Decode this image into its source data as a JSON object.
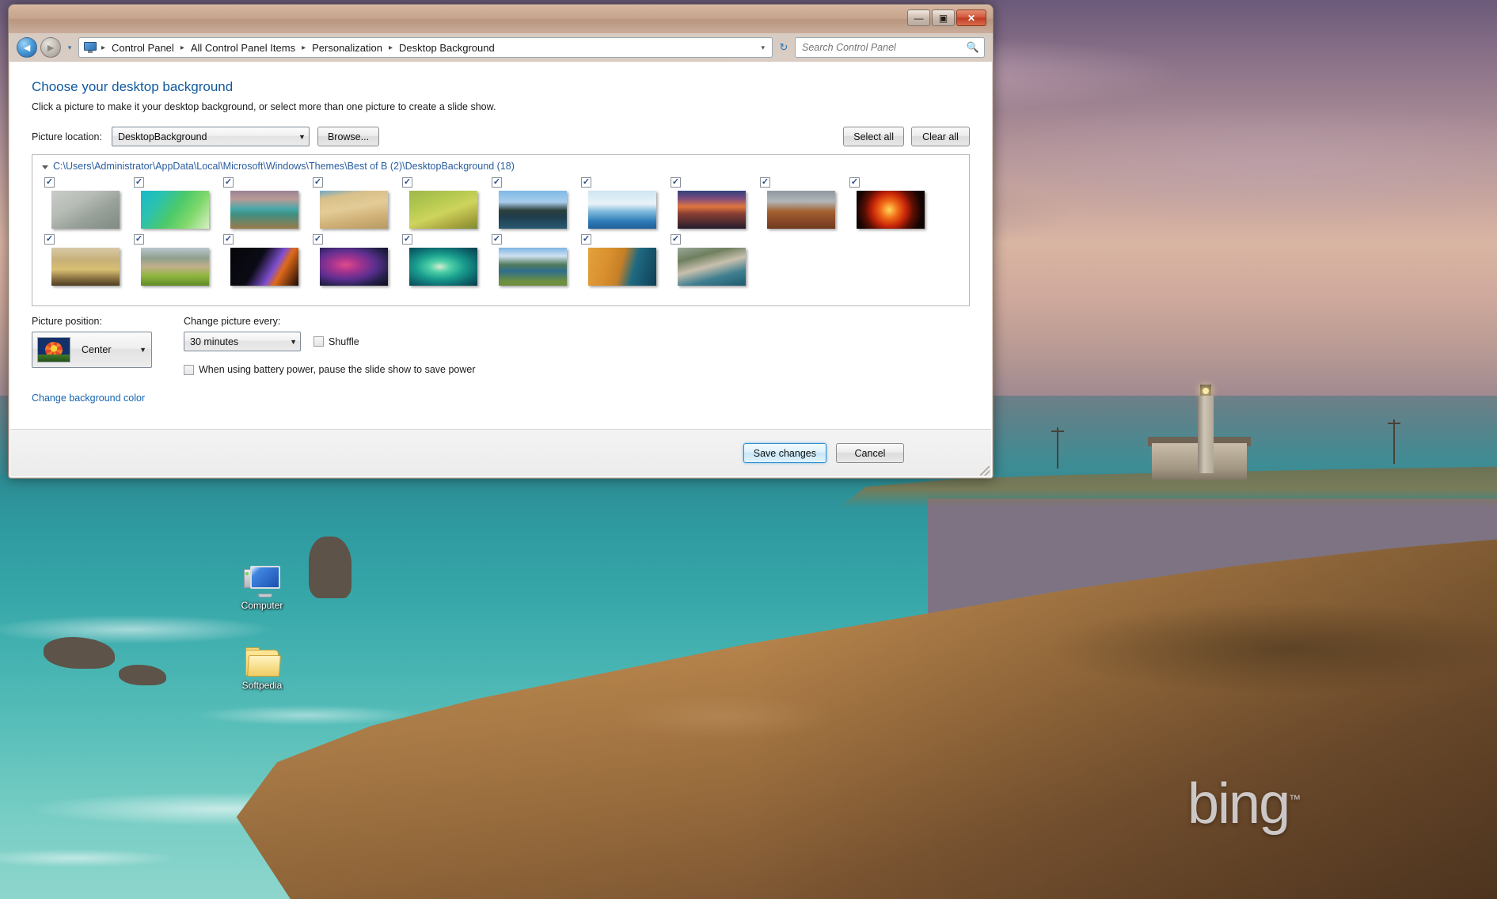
{
  "window": {
    "controls": {
      "minimize": "—",
      "maximize": "▣",
      "close": "✕"
    },
    "address": {
      "breadcrumbs": [
        "Control Panel",
        "All Control Panel Items",
        "Personalization",
        "Desktop Background"
      ],
      "separator": "▸",
      "dropdown_caret": "▾",
      "refresh": "↻"
    },
    "search": {
      "placeholder": "Search Control Panel",
      "value": "",
      "icon": "search-icon"
    },
    "nav": {
      "back": "◄",
      "forward": "►",
      "history_caret": "▾"
    }
  },
  "page": {
    "title": "Choose your desktop background",
    "subtitle": "Click a picture to make it your desktop background, or select more than one picture to create a slide show."
  },
  "picture_location": {
    "label": "Picture location:",
    "selected": "DesktopBackground",
    "browse_label": "Browse..."
  },
  "selection_buttons": {
    "select_all": "Select all",
    "clear_all": "Clear all"
  },
  "gallery": {
    "group_header": "C:\\Users\\Administrator\\AppData\\Local\\Microsoft\\Windows\\Themes\\Best of B (2)\\DesktopBackground (18)",
    "collapse_icon": "▲",
    "items": [
      {
        "name": "thumb-whale-tail",
        "checked": true,
        "css": "linear-gradient(150deg,#c9ccc8 0%,#b7bcb6 35%,#9aa39b 60%,#7f8a82 100%)"
      },
      {
        "name": "thumb-green-aerial",
        "checked": true,
        "css": "linear-gradient(125deg,#17b9c9 0%,#2ac2b0 25%,#4cc96a 50%,#7fd86b 72%,#d8efc4 100%)"
      },
      {
        "name": "thumb-coastal-cliff",
        "checked": true,
        "css": "linear-gradient(180deg,#9a8496 0%,#b99a96 22%,#46a8a8 48%,#3f8f80 62%,#9a7a4a 100%)"
      },
      {
        "name": "thumb-desert-dune",
        "checked": true,
        "css": "linear-gradient(170deg,#6da9c9 0%,#d9c08a 18%,#e3cb97 45%,#cdae74 75%,#b69a63 100%)"
      },
      {
        "name": "thumb-fox-in-grass",
        "checked": true,
        "css": "linear-gradient(160deg,#9fb84c 0%,#b3c84f 30%,#cdd45c 55%,#a9a63f 80%,#7e8a33 100%)"
      },
      {
        "name": "thumb-lake-reflection",
        "checked": true,
        "css": "linear-gradient(180deg,#7fb9e6 0%,#a8cdec 30%,#2b3f3a 52%,#1f3e4f 70%,#2a5a72 100%)"
      },
      {
        "name": "thumb-ice-floes",
        "checked": true,
        "css": "linear-gradient(180deg,#cfe6f2 0%,#e8f2f7 35%,#7fb9dc 55%,#2f7cb8 80%,#1e5f9a 100%)"
      },
      {
        "name": "thumb-city-sunset",
        "checked": true,
        "css": "linear-gradient(180deg,#31407a 0%,#7a4a7e 20%,#e0763f 42%,#8a3f33 60%,#241c2c 100%)"
      },
      {
        "name": "thumb-monument-valley",
        "checked": true,
        "css": "linear-gradient(180deg,#8f99a0 0%,#b0b6b8 28%,#a3602f 55%,#8a4a28 78%,#6e3a20 100%)"
      },
      {
        "name": "thumb-solar-flare",
        "checked": true,
        "css": "radial-gradient(circle at 48% 50%, #ffd75a 0%, #f06a16 22%, #c52408 42%, #5c0f04 60%, #120402 82%)"
      },
      {
        "name": "thumb-golden-palace",
        "checked": true,
        "css": "linear-gradient(180deg,#d8c9a8 0%,#c7b079 32%,#d8bf72 58%,#8c7342 80%,#4e3e22 100%)"
      },
      {
        "name": "thumb-lions-savanna",
        "checked": true,
        "css": "linear-gradient(180deg,#b9c7cf 0%,#8fa08c 28%,#c3b08a 50%,#8eb63f 74%,#5f8a26 100%)"
      },
      {
        "name": "thumb-lava-lightning",
        "checked": true,
        "css": "linear-gradient(120deg,#050509 0%,#0b0b16 40%,#7f4fd0 62%,#e06a1a 72%,#1a0a06 100%)"
      },
      {
        "name": "thumb-nebula",
        "checked": true,
        "css": "radial-gradient(ellipse at 38% 45%, #e04a8c 0%, #a0338f 25%, #5c2f8f 50%, #24204a 75%, #0d0b1c 100%)"
      },
      {
        "name": "thumb-atoll-island",
        "checked": true,
        "css": "radial-gradient(ellipse at 45% 50%, #d8e9d0 0%, #4fd0a8 20%, #1a9f8e 45%, #0d6a6f 72%, #073c4a 100%)"
      },
      {
        "name": "thumb-mountain-lake",
        "checked": true,
        "css": "linear-gradient(180deg,#7cb5e4 0%,#cfe2f0 22%,#4f7a5c 45%,#2f6f8c 62%,#6d8f3f 88%)"
      },
      {
        "name": "thumb-sand-coastline",
        "checked": true,
        "css": "linear-gradient(105deg,#e3a13c 0%,#d98f2e 30%,#c57f26 48%,#1f6a82 66%,#0e3f55 100%)"
      },
      {
        "name": "thumb-amalfi-coast",
        "checked": true,
        "css": "linear-gradient(165deg,#9aa89a 0%,#6f7f5e 25%,#c8c0ae 48%,#3f7f8f 72%,#1f5a72 100%)"
      }
    ]
  },
  "picture_position": {
    "label": "Picture position:",
    "selected": "Center",
    "arrow": "▾"
  },
  "change_picture": {
    "label": "Change picture every:",
    "selected": "30 minutes",
    "arrow": "▾"
  },
  "shuffle": {
    "label": "Shuffle",
    "checked": false
  },
  "battery": {
    "label": "When using battery power, pause the slide show to save power",
    "checked": false
  },
  "change_color_link": "Change background color",
  "footer": {
    "save": "Save changes",
    "cancel": "Cancel"
  },
  "desktop": {
    "icons": [
      {
        "name": "desktop-icon-computer",
        "label": "Computer",
        "type": "monitor"
      },
      {
        "name": "desktop-icon-softpedia",
        "label": "Softpedia",
        "type": "folder"
      }
    ],
    "watermark": {
      "text": "bing",
      "tm": "™"
    }
  }
}
